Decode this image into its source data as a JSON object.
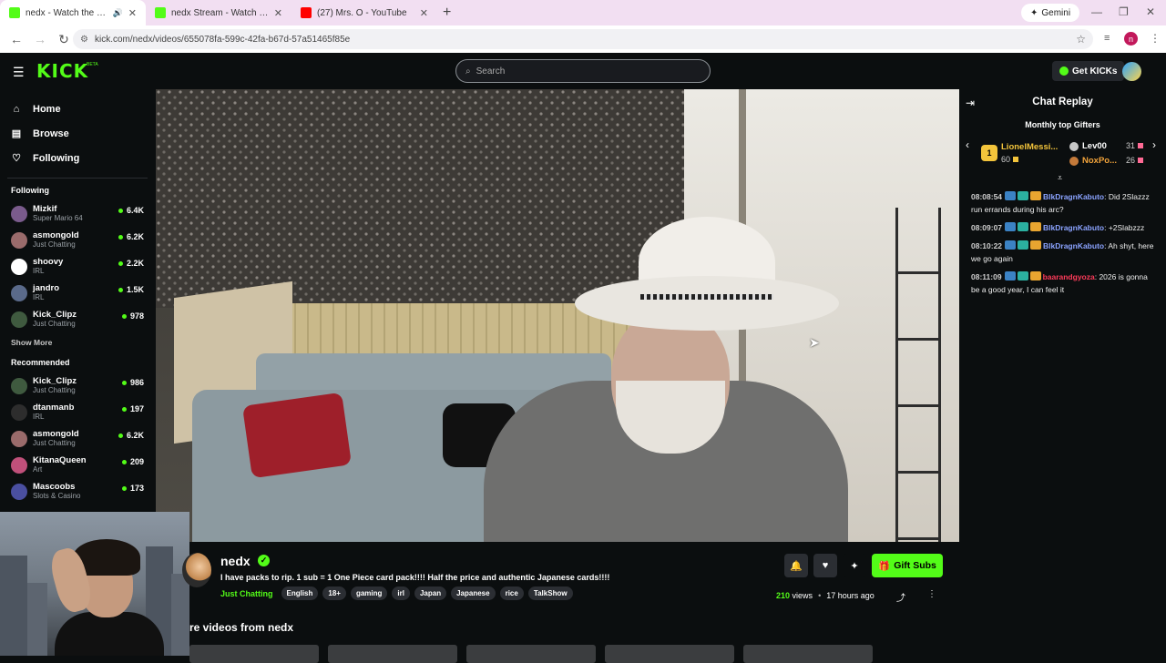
{
  "browser": {
    "tabs": [
      {
        "title": "nedx - Watch the VOD on Kick",
        "active": true,
        "favicon_color": "#53fc18"
      },
      {
        "title": "nedx Stream - Watch Live on Kick",
        "active": false,
        "favicon_color": "#53fc18"
      },
      {
        "title": "(27) Mrs. O - YouTube",
        "active": false,
        "favicon_color": "#ff0000"
      }
    ],
    "new_tab": "+",
    "gemini_label": "Gemini",
    "url": "kick.com/nedx/videos/655078fa-599c-42fa-b67d-57a51465f85e",
    "profile_initial": "n"
  },
  "header": {
    "logo": "KICK",
    "beta": "BETA",
    "search_placeholder": "Search",
    "get_kicks_label": "Get KICKs"
  },
  "sidebar": {
    "nav": [
      {
        "label": "Home",
        "icon": "home-icon"
      },
      {
        "label": "Browse",
        "icon": "browse-icon"
      },
      {
        "label": "Following",
        "icon": "heart-icon"
      }
    ],
    "following_heading": "Following",
    "following": [
      {
        "name": "Mizkif",
        "category": "Super Mario 64",
        "viewers": "6.4K",
        "color": "#7a5b8c"
      },
      {
        "name": "asmongold",
        "category": "Just Chatting",
        "viewers": "6.2K",
        "color": "#9a6b6b"
      },
      {
        "name": "shoovy",
        "category": "IRL",
        "viewers": "2.2K",
        "color": "#ffffff"
      },
      {
        "name": "jandro",
        "category": "IRL",
        "viewers": "1.5K",
        "color": "#5a6a8a"
      },
      {
        "name": "Kick_Clipz",
        "category": "Just Chatting",
        "viewers": "978",
        "color": "#3f5a3f"
      }
    ],
    "show_more": "Show More",
    "recommended_heading": "Recommended",
    "recommended": [
      {
        "name": "Kick_Clipz",
        "category": "Just Chatting",
        "viewers": "986",
        "color": "#3f5a3f"
      },
      {
        "name": "dtanmanb",
        "category": "IRL",
        "viewers": "197",
        "color": "#2d2d2d"
      },
      {
        "name": "asmongold",
        "category": "Just Chatting",
        "viewers": "6.2K",
        "color": "#9a6b6b"
      },
      {
        "name": "KitanaQueen",
        "category": "Art",
        "viewers": "209",
        "color": "#c0507a"
      },
      {
        "name": "Mascoobs",
        "category": "Slots & Casino",
        "viewers": "173",
        "color": "#4a4fa0"
      }
    ]
  },
  "stream": {
    "channel": "nedx",
    "title": "I have packs to rip. 1 sub = 1 One Piece card pack!!!! Half the price and authentic Japanese cards!!!!",
    "category": "Just Chatting",
    "tags": [
      "English",
      "18+",
      "gaming",
      "irl",
      "Japan",
      "Japanese",
      "rice",
      "TalkShow"
    ],
    "views_count": "210",
    "views_label": "views",
    "age": "17 hours ago",
    "gift_subs_label": "Gift Subs",
    "more_videos_heading": "re videos from nedx"
  },
  "chat": {
    "title": "Chat Replay",
    "gifters_title": "Monthly top Gifters",
    "top_gifters": [
      {
        "rank": "1",
        "name": "LionelMessi...",
        "count": "60"
      },
      {
        "rank": "2",
        "name": "Lev00",
        "count": "31"
      },
      {
        "rank": "3",
        "name": "NoxPo...",
        "count": "26"
      }
    ],
    "messages": [
      {
        "time": "08:08:54",
        "user": "BlkDragnKabuto",
        "text": ": Did 2Slazzz run errands during his arc?",
        "user_color": "u1"
      },
      {
        "time": "08:09:07",
        "user": "BlkDragnKabuto",
        "text": ": +2Slabzzz",
        "user_color": "u1"
      },
      {
        "time": "08:10:22",
        "user": "BlkDragnKabuto",
        "text": ": Ah shyt, here we go again",
        "user_color": "u1"
      },
      {
        "time": "08:11:09",
        "user": "baarandgyoza",
        "text": ": 2026 is gonna be a good year, I can feel it",
        "user_color": "u2"
      }
    ]
  }
}
